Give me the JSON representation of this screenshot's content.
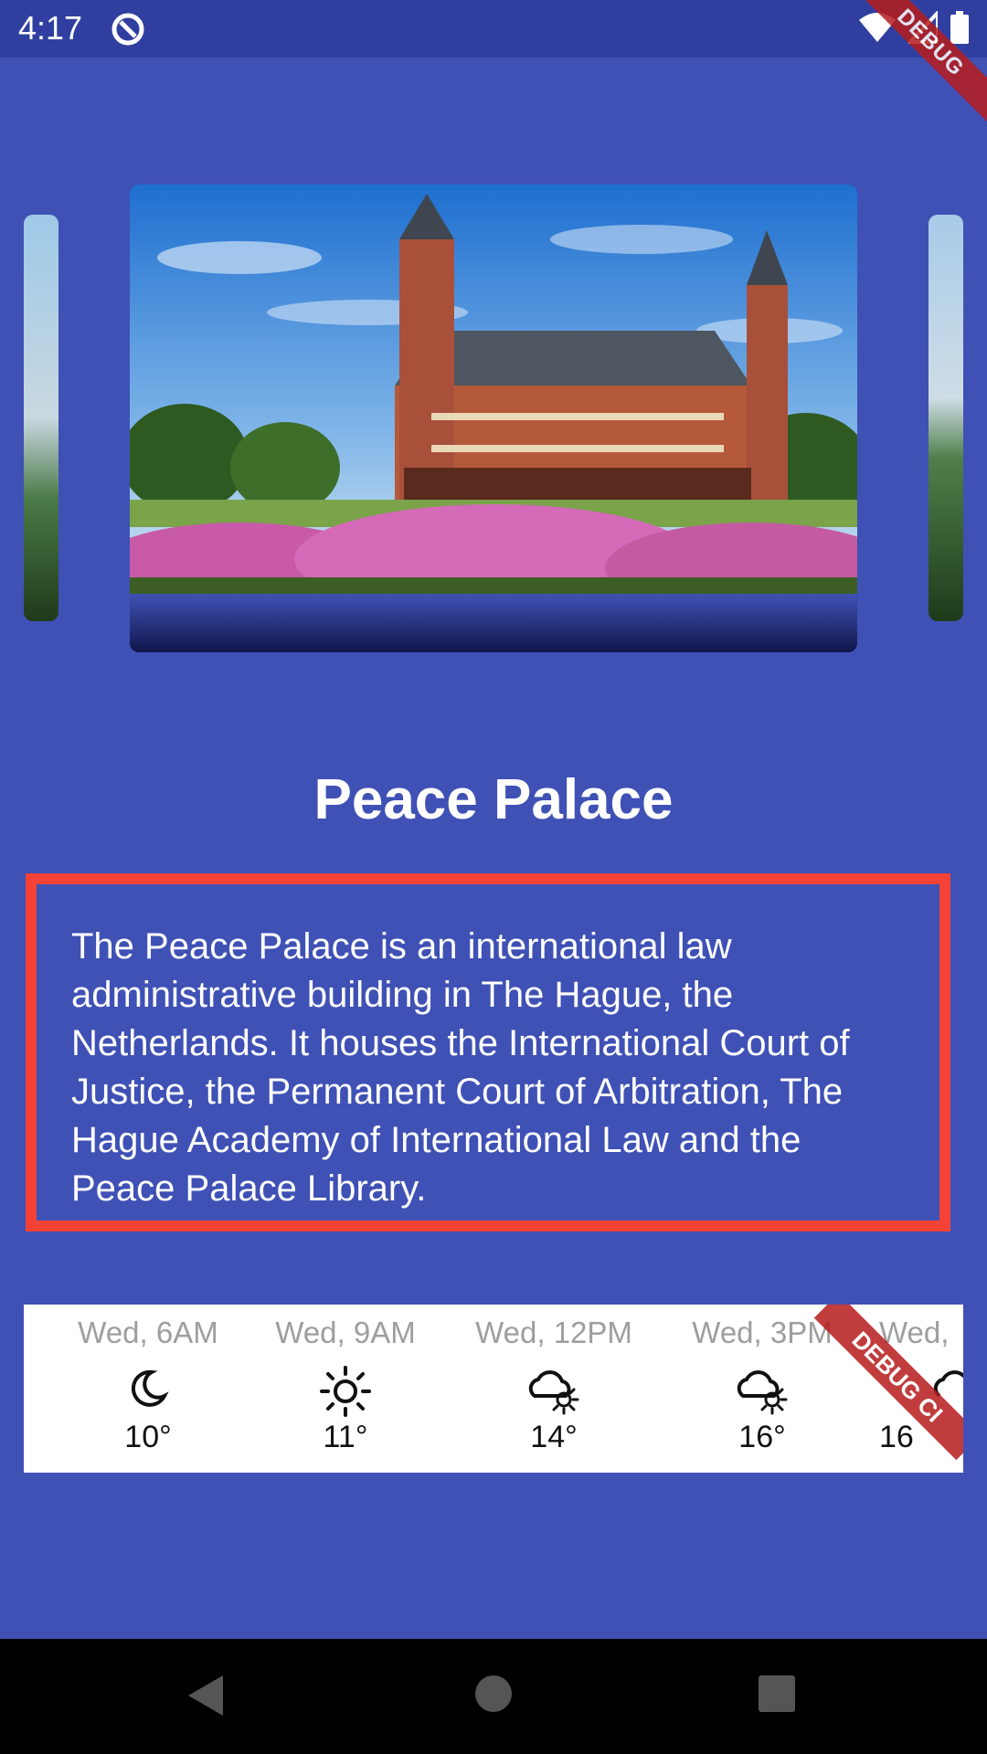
{
  "status_bar": {
    "time": "4:17"
  },
  "debug_label": "DEBUG",
  "place": {
    "title": "Peace Palace",
    "description": "The Peace Palace is an international law administrative building in The Hague, the Netherlands. It houses the International Court of Justice, the Permanent Court of Arbitration, The Hague Academy of International Law and the Peace Palace Library."
  },
  "forecast": [
    {
      "time": "Wed, 6AM",
      "icon": "moon-icon",
      "temp": "10°"
    },
    {
      "time": "Wed, 9AM",
      "icon": "sun-icon",
      "temp": "11°"
    },
    {
      "time": "Wed, 12PM",
      "icon": "cloud-sun-icon",
      "temp": "14°"
    },
    {
      "time": "Wed, 3PM",
      "icon": "cloud-sun-icon",
      "temp": "16°"
    },
    {
      "time": "Wed,",
      "icon": "cloud-sun-icon",
      "temp": "16"
    }
  ],
  "colors": {
    "background": "#3f51b5",
    "status_bar": "#303f9f",
    "highlight_border": "#f44336"
  }
}
